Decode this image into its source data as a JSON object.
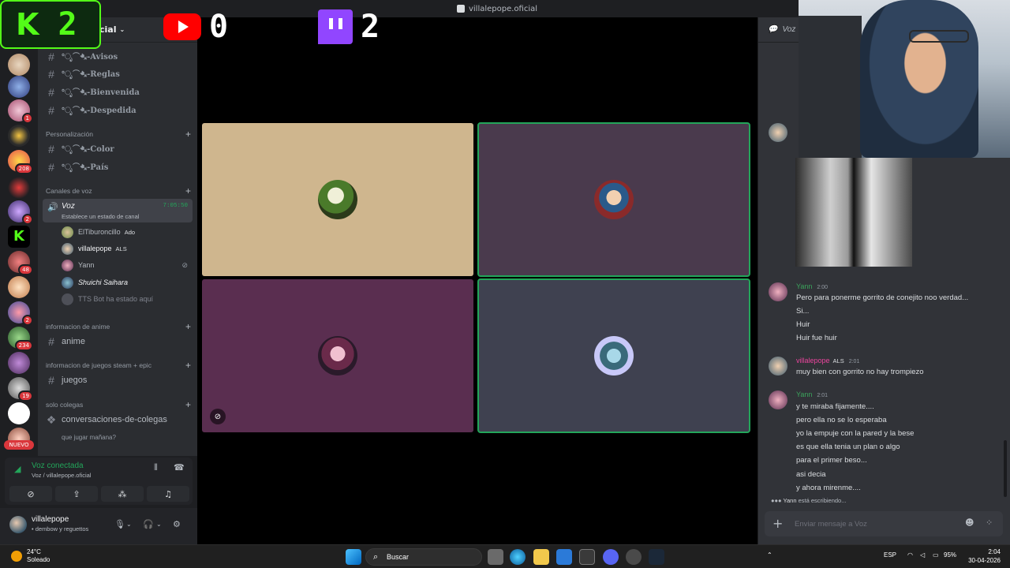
{
  "window": {
    "title": "villalepope.oficial"
  },
  "overlay": {
    "kick_count": "2",
    "youtube_count": "0",
    "twitch_count": "2"
  },
  "server": {
    "name": "cial"
  },
  "rail": {
    "badges": [
      "1",
      "208",
      "2",
      "48",
      "2",
      "234",
      "19"
    ],
    "nuevo": "NUEVO"
  },
  "channels": {
    "top": [
      "°ೃ⁀➷-Avisos",
      "°ೃ⁀➷-Reglas",
      "°ೃ⁀➷-Bienvenida",
      "°ೃ⁀➷-Despedida"
    ],
    "personalizacion_label": "Personalización",
    "personalizacion": [
      "°ೃ⁀➷-Color",
      "°ೃ⁀➷-País"
    ],
    "voz_label": "Canales de voz",
    "voz_channel": {
      "name": "Voz",
      "status": "Establece un estado de canal",
      "timer": "7:05:50"
    },
    "voice_users": [
      {
        "name": "ElTiburoncillo",
        "tag": "Ado"
      },
      {
        "name": "villalepope",
        "tag": "ALS"
      },
      {
        "name": "Yann",
        "tag": ""
      },
      {
        "name": "Shuichi Saihara",
        "tag": ""
      },
      {
        "name": "TTS Bot ha estado aquí",
        "tag": ""
      }
    ],
    "anime_label": "informacion de anime",
    "anime": "anime",
    "juegos_label": "informacion de juegos steam + epic",
    "juegos": "juegos",
    "solo_label": "solo colegas",
    "solo": "conversaciones-de-colegas",
    "thread": "que jugar mañana?"
  },
  "voice_panel": {
    "status": "Voz conectada",
    "location": "Voz / villalepope.oficial"
  },
  "user": {
    "name": "villalepope",
    "status": "• dembow y reguettos"
  },
  "tiles": {
    "colors": [
      "#cfb68e",
      "#4a3a4d",
      "#5a2e50",
      "#3f4150"
    ]
  },
  "chat": {
    "header": "Voz",
    "messages": [
      {
        "author": "Yann",
        "time": "2:00",
        "color": "#3ba55c",
        "lines": [
          "Pero para ponerme gorrito de conejito noo verdad...",
          "Si...",
          "Huir",
          "Huir fue huir"
        ]
      },
      {
        "author": "villalepope",
        "time": "2:01",
        "tag": "ALS",
        "color": "#eb459e",
        "lines": [
          "muy bien con gorrito no hay trompiezo"
        ]
      },
      {
        "author": "Yann",
        "time": "2:01",
        "color": "#3ba55c",
        "lines": [
          "y te miraba fijamente....",
          "pero ella no se lo esperaba",
          "yo la empuje con la pared y la bese",
          "es que ella tenia un plan o algo",
          "para el primer beso...",
          "asi decia",
          "y ahora mirenme...."
        ]
      }
    ],
    "typing_user": "Yann",
    "typing_text": " está escribiendo...",
    "composer_placeholder": "Enviar mensaje a Voz"
  },
  "taskbar": {
    "weather_temp": "24°C",
    "weather_desc": "Soleado",
    "search": "Buscar",
    "lang": "ESP",
    "battery": "95%",
    "time": "2:04",
    "date": "30-04-2026"
  }
}
